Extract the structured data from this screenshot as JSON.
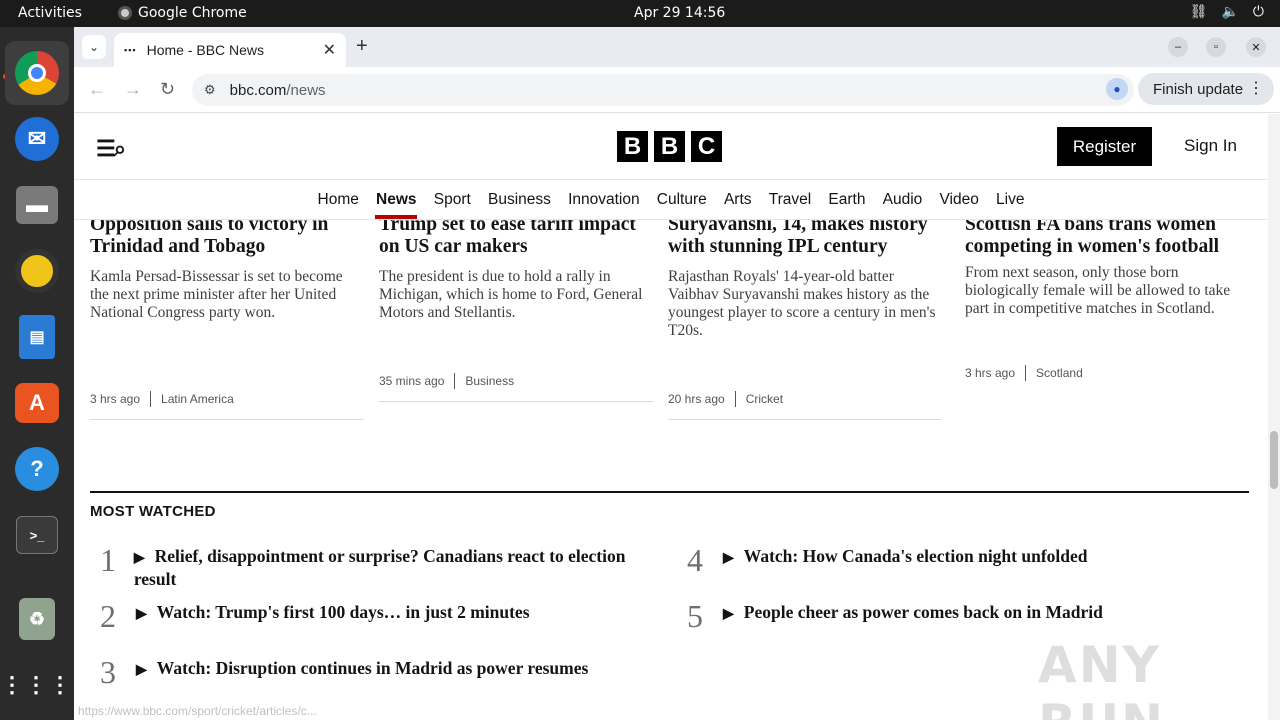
{
  "topbar": {
    "activities": "Activities",
    "app_name": "Google Chrome",
    "clock": "Apr 29  14:56",
    "tray_icons": [
      "network-icon",
      "volume-icon",
      "power-icon"
    ]
  },
  "dock": {
    "items": [
      "chrome",
      "thunderbird",
      "files",
      "rhythmbox",
      "writer",
      "app-center",
      "help",
      "terminal",
      "trash",
      "show-apps"
    ]
  },
  "browser": {
    "tab_title": "Home - BBC News",
    "url_host": "bbc.com",
    "url_path": "/news",
    "finish_update": "Finish update"
  },
  "bbc": {
    "logo": [
      "B",
      "B",
      "C"
    ],
    "register": "Register",
    "sign_in": "Sign In",
    "nav": [
      "Home",
      "News",
      "Sport",
      "Business",
      "Innovation",
      "Culture",
      "Arts",
      "Travel",
      "Earth",
      "Audio",
      "Video",
      "Live"
    ],
    "nav_active": "News",
    "stories": [
      {
        "headline_top": "Opposition sails to victory in",
        "headline_bottom": "Trinidad and Tobago",
        "summary": "Kamla Persad-Bissessar is set to become the next prime minister after her United National Congress party won.",
        "time": "3 hrs ago",
        "section": "Latin America"
      },
      {
        "headline_top": "Trump set to ease tariff impact",
        "headline_bottom": "on US car makers",
        "summary": "The president is due to hold a rally in Michigan, which is home to Ford, General Motors and Stellantis.",
        "time": "35 mins ago",
        "section": "Business"
      },
      {
        "headline_top": "Suryavanshi, 14, makes history",
        "headline_bottom": "with stunning IPL century",
        "summary": "Rajasthan Royals' 14-year-old batter Vaibhav Suryavanshi makes history as the youngest player to score a century in men's T20s.",
        "time": "20 hrs ago",
        "section": "Cricket"
      },
      {
        "headline_top": "Scottish FA bans trans women",
        "headline_bottom": "competing in women's football",
        "summary": "From next season, only those born biologically female will be allowed to take part in competitive matches in Scotland.",
        "time": "3 hrs ago",
        "section": "Scotland"
      }
    ],
    "most_watched_title": "MOST WATCHED",
    "most_watched": [
      {
        "num": "1",
        "text": "Relief, disappointment or surprise? Canadians react to election result"
      },
      {
        "num": "2",
        "text": "Watch: Trump's first 100 days… in just 2 minutes"
      },
      {
        "num": "3",
        "text": "Watch: Disruption continues in Madrid as power resumes"
      },
      {
        "num": "4",
        "text": "Watch: How Canada's election night unfolded"
      },
      {
        "num": "5",
        "text": "People cheer as power comes back on in Madrid"
      }
    ]
  },
  "overlay": {
    "watermark": "ANY RUN",
    "status_url": "https://www.bbc.com/sport/cricket/articles/c..."
  }
}
